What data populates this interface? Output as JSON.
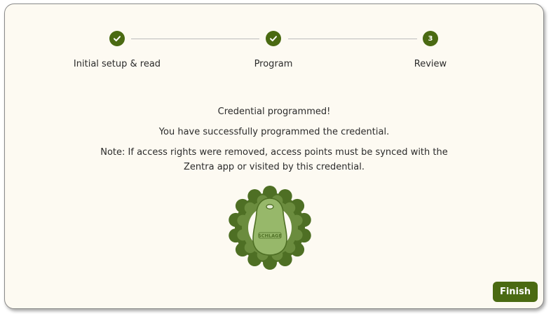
{
  "stepper": {
    "steps": [
      {
        "label": "Initial setup & read",
        "state": "completed",
        "marker": ""
      },
      {
        "label": "Program",
        "state": "completed",
        "marker": ""
      },
      {
        "label": "Review",
        "state": "current",
        "marker": "3"
      }
    ]
  },
  "content": {
    "title": "Credential programmed!",
    "success_message": "You have successfully programmed the credential.",
    "note_line1": "Note: If access rights were removed, access points must be synced with the",
    "note_line2": "Zentra app or visited by this credential."
  },
  "badge": {
    "icon": "programmed-key-fob-badge-icon",
    "fob_text": "SCHLAGE"
  },
  "footer": {
    "finish_label": "Finish"
  },
  "colors": {
    "accent": "#4a6a12",
    "background": "#fdfaf2",
    "badge_dark": "#4e6f24",
    "badge_mid": "#6b8c3e",
    "fob": "#97b86a"
  }
}
